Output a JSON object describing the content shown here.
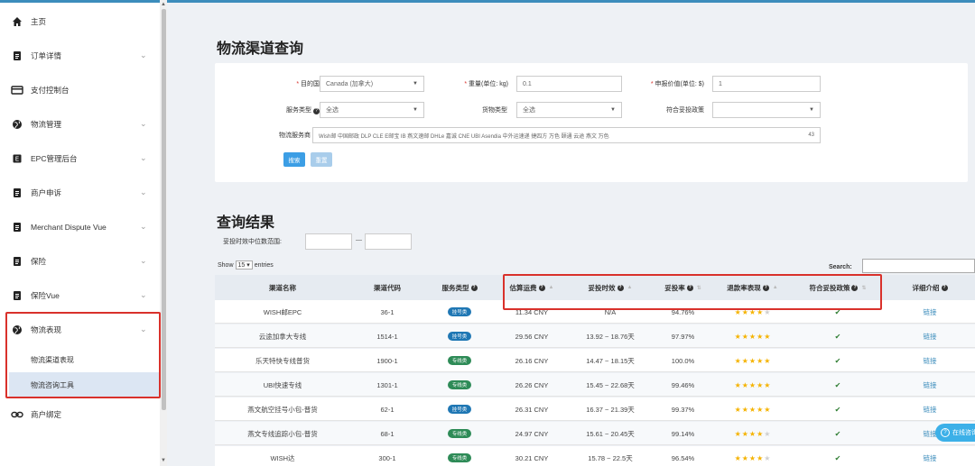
{
  "sidebar": {
    "items": [
      {
        "label": "主页",
        "icon": "home-icon",
        "chevron": false
      },
      {
        "label": "订单详情",
        "icon": "document-icon",
        "chevron": true
      },
      {
        "label": "支付控制台",
        "icon": "card-icon",
        "chevron": false
      },
      {
        "label": "物流管理",
        "icon": "globe-icon",
        "chevron": true
      },
      {
        "label": "EPC管理后台",
        "icon": "ebox-icon",
        "chevron": true
      },
      {
        "label": "商户申诉",
        "icon": "document-icon",
        "chevron": true
      },
      {
        "label": "Merchant Dispute Vue",
        "icon": "document-icon",
        "chevron": true
      },
      {
        "label": "保险",
        "icon": "document-icon",
        "chevron": true
      },
      {
        "label": "保险Vue",
        "icon": "document-icon",
        "chevron": true
      },
      {
        "label": "物流表现",
        "icon": "globe-icon",
        "chevron": true
      }
    ],
    "sub_items": [
      "物流渠道表现",
      "物流咨询工具"
    ],
    "last_item": {
      "label": "商户绑定",
      "icon": "link-icon"
    }
  },
  "page_title": "物流渠道查询",
  "filters": {
    "dest_label": "目的国",
    "dest_value": "Canada (加拿大)",
    "weight_label": "重量(单位: kg)",
    "weight_value": "0.1",
    "declared_label": "申报价值(单位: $)",
    "declared_value": "1",
    "service_label": "服务类型",
    "service_value": "全选",
    "goods_label": "货物类型",
    "goods_value": "全选",
    "policy_label": "符合妥投政策",
    "policy_value": "",
    "provider_label": "物流服务商",
    "provider_value": "Wish邮 中国邮政 DLP CLE E邮宝 IB 燕文速邮 DHLe 嘉诚 CNE UBI Asendia 中外运速递 捷四方 万色 颐通 云途 燕文 万色",
    "provider_count": "43",
    "search_btn": "搜索",
    "reset_btn": "重置"
  },
  "results_title": "查询结果",
  "range_label": "妥投时效中位数范围:",
  "range_dash": "—",
  "show_label": "Show",
  "show_value": "15",
  "entries_label": "entries",
  "search_label": "Search:",
  "table": {
    "columns": [
      "渠道名称",
      "渠道代码",
      "服务类型",
      "估算运费",
      "妥投时效",
      "妥投率",
      "退款率表现",
      "符合妥投政策",
      "详细介绍"
    ],
    "rows": [
      {
        "name": "WISH邮EPC",
        "code": "36-1",
        "type": "挂号类",
        "cost": "11.34 CNY",
        "time": "N/A",
        "rate": "94.76%",
        "stars": 4,
        "link": "链接"
      },
      {
        "name": "云途加拿大专线",
        "code": "1514-1",
        "type": "挂号类",
        "cost": "29.56 CNY",
        "time": "13.92 ~ 18.76天",
        "rate": "97.97%",
        "stars": 5,
        "link": "链接"
      },
      {
        "name": "乐天特快专线普货",
        "code": "1900-1",
        "type": "专线类",
        "cost": "26.16 CNY",
        "time": "14.47 ~ 18.15天",
        "rate": "100.0%",
        "stars": 5,
        "link": "链接"
      },
      {
        "name": "UBI快速专线",
        "code": "1301-1",
        "type": "专线类",
        "cost": "26.26 CNY",
        "time": "15.45 ~ 22.68天",
        "rate": "99.46%",
        "stars": 5,
        "link": "链接"
      },
      {
        "name": "燕文航空挂号小包-普货",
        "code": "62-1",
        "type": "挂号类",
        "cost": "26.31 CNY",
        "time": "16.37 ~ 21.39天",
        "rate": "99.37%",
        "stars": 5,
        "link": "链接"
      },
      {
        "name": "燕文专线追踪小包-普货",
        "code": "68-1",
        "type": "专线类",
        "cost": "24.97 CNY",
        "time": "15.61 ~ 20.45天",
        "rate": "99.14%",
        "stars": 4,
        "link": "链接"
      },
      {
        "name": "WISH达",
        "code": "300-1",
        "type": "专线类",
        "cost": "30.21 CNY",
        "time": "15.78 ~ 22.5天",
        "rate": "96.54%",
        "stars": 4,
        "link": "链接"
      }
    ]
  },
  "chat_label": "在线咨询",
  "colors": {
    "accent": "#3c8dbc",
    "highlight": "#d9312b",
    "star": "#f5b301"
  }
}
